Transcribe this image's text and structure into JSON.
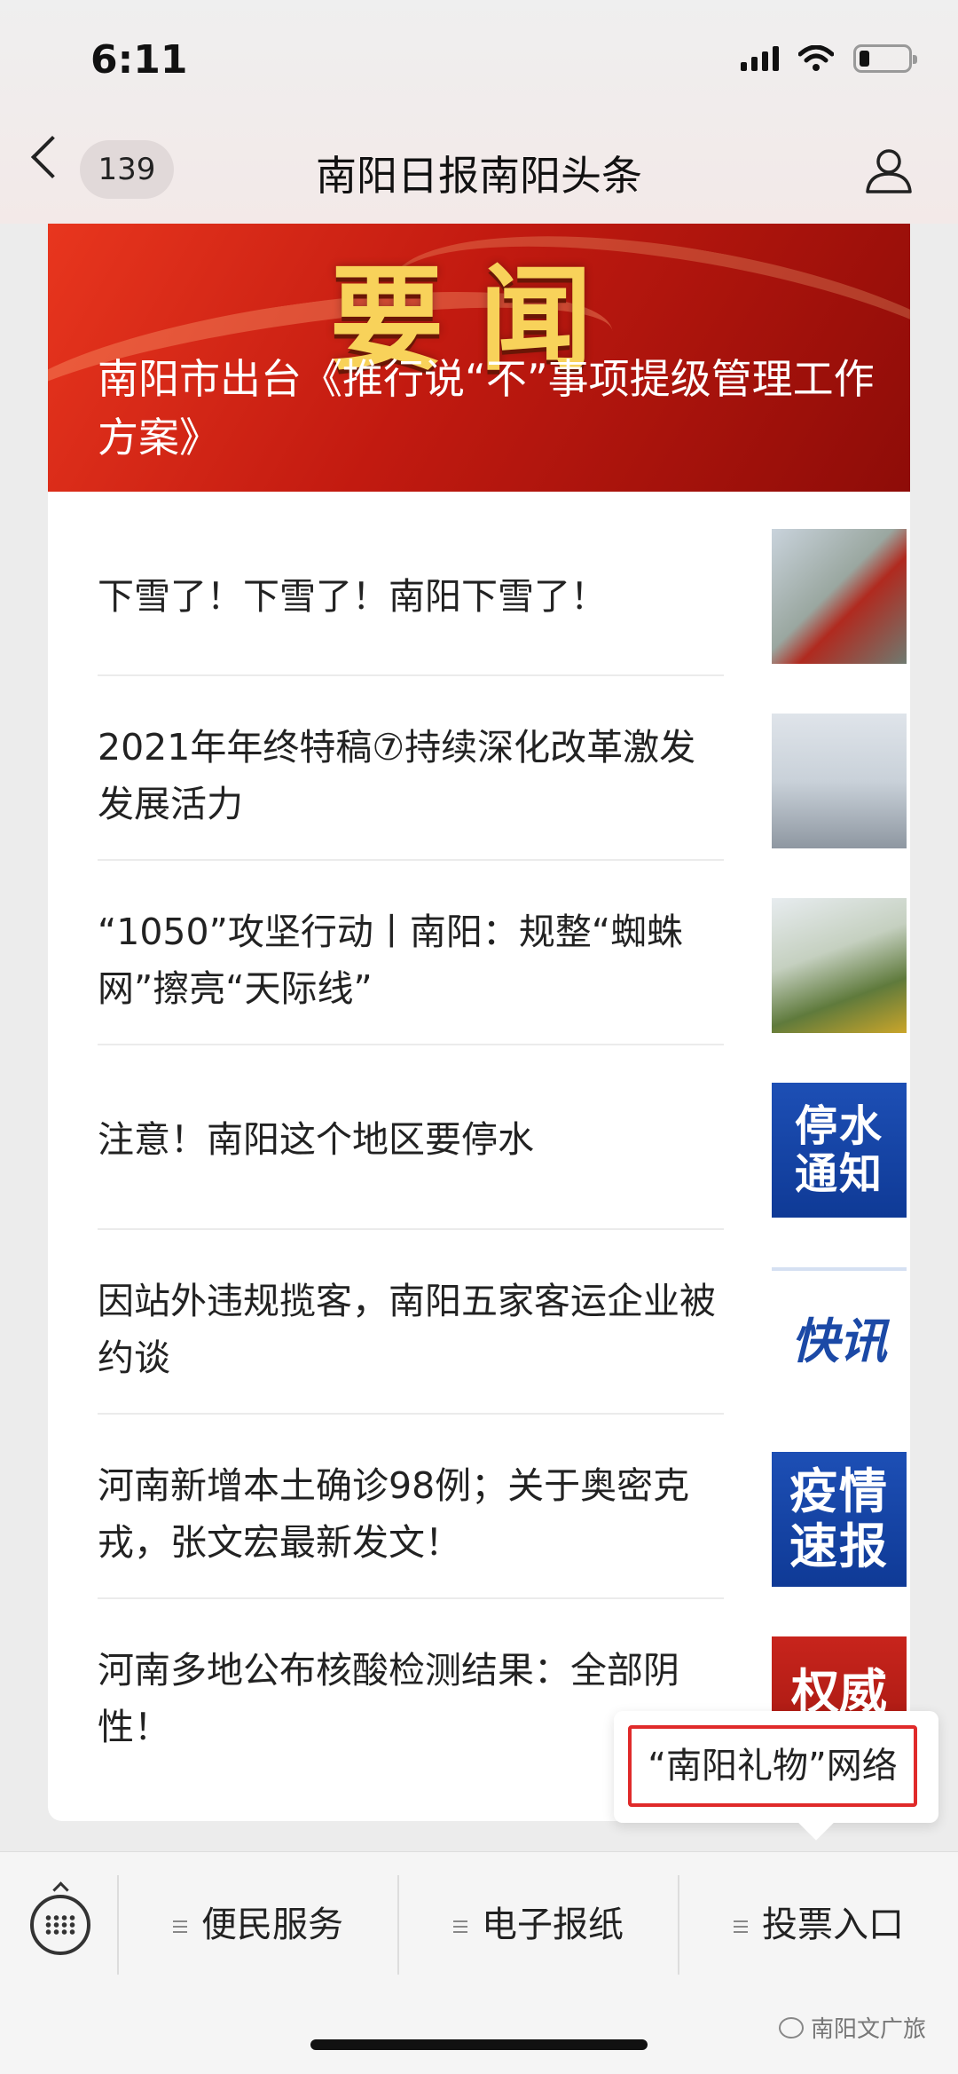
{
  "status_bar": {
    "time": "6:11",
    "battery_level": 0.2
  },
  "header": {
    "back_count": "139",
    "title": "南阳日报南阳头条"
  },
  "banner": {
    "big_text": "要闻",
    "headline": "南阳市出台《推行说“不”事项提级管理工作方案》"
  },
  "news": [
    {
      "title": "下雪了！下雪了！南阳下雪了！",
      "thumb": ""
    },
    {
      "title": "2021年年终特稿⑦持续深化改革激发发展活力",
      "thumb": ""
    },
    {
      "title": "“1050”攻坚行动丨南阳：规整“蜘蛛网”擦亮“天际线”",
      "thumb": ""
    },
    {
      "title": "注意！南阳这个地区要停水",
      "thumb": "停水\n通知"
    },
    {
      "title": "因站外违规揽客，南阳五家客运企业被约谈",
      "thumb": "快讯"
    },
    {
      "title": "河南新增本土确诊98例；关于奥密克戎，张文宏最新发文！",
      "thumb": "疫情\n速报"
    },
    {
      "title": "河南多地公布核酸检测结果：全部阴性！",
      "thumb": "权威"
    }
  ],
  "popup": {
    "item": "“南阳礼物”网络"
  },
  "menu": {
    "items": [
      "便民服务",
      "电子报纸",
      "投票入口"
    ]
  },
  "watermark": "南阳文广旅"
}
